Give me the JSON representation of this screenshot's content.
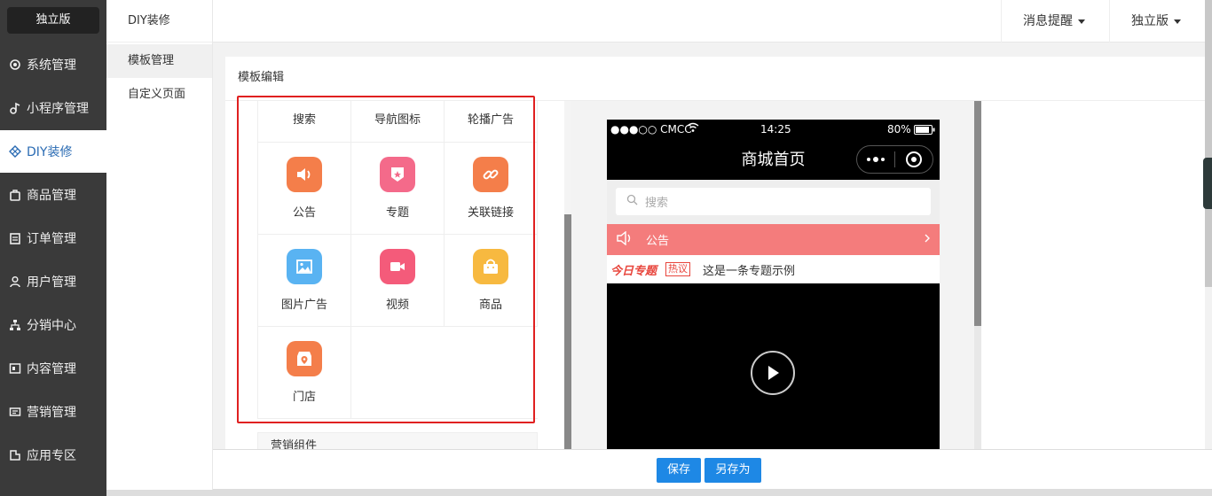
{
  "sidebar": {
    "brand": "独立版",
    "items": [
      {
        "label": "系统管理",
        "icon": "gear-icon"
      },
      {
        "label": "小程序管理",
        "icon": "music-note-icon"
      },
      {
        "label": "DIY装修",
        "icon": "diy-icon"
      },
      {
        "label": "商品管理",
        "icon": "bag-icon"
      },
      {
        "label": "订单管理",
        "icon": "clipboard-icon"
      },
      {
        "label": "用户管理",
        "icon": "user-icon"
      },
      {
        "label": "分销中心",
        "icon": "hierarchy-icon"
      },
      {
        "label": "内容管理",
        "icon": "content-icon"
      },
      {
        "label": "营销管理",
        "icon": "marketing-icon"
      },
      {
        "label": "应用专区",
        "icon": "app-icon"
      }
    ]
  },
  "subnav": {
    "title": "DIY装修",
    "items": [
      {
        "label": "模板管理"
      },
      {
        "label": "自定义页面"
      }
    ]
  },
  "topbar": {
    "messages": "消息提醒",
    "edition": "独立版"
  },
  "main": {
    "title": "模板编辑"
  },
  "components": {
    "tabs": [
      "搜索",
      "导航图标",
      "轮播广告"
    ],
    "items": [
      {
        "label": "公告",
        "icon": "speaker-icon",
        "color": "#f47e4a"
      },
      {
        "label": "专题",
        "icon": "badge-icon",
        "color": "#f46a8a"
      },
      {
        "label": "关联链接",
        "icon": "link-icon",
        "color": "#f47e4a"
      },
      {
        "label": "图片广告",
        "icon": "image-icon",
        "color": "#59b3f2"
      },
      {
        "label": "视频",
        "icon": "video-icon",
        "color": "#f45b7a"
      },
      {
        "label": "商品",
        "icon": "shopping-bag-icon",
        "color": "#f7b940"
      },
      {
        "label": "门店",
        "icon": "store-icon",
        "color": "#f47e4a"
      }
    ],
    "section_marketing": "营销组件"
  },
  "phone": {
    "carrier": "●●●○○ CMCC",
    "time": "14:25",
    "battery": "80%",
    "title": "商城首页",
    "search_placeholder": "搜索",
    "notice": "公告",
    "topic_logo": "今日专题",
    "topic_tag": "热议",
    "topic_text": "这是一条专题示例"
  },
  "footer": {
    "save": "保存",
    "save_as": "另存为"
  },
  "colors": {
    "accent": "#1e88e5",
    "notice": "#f47c7c",
    "highlight_frame": "#e02020"
  }
}
